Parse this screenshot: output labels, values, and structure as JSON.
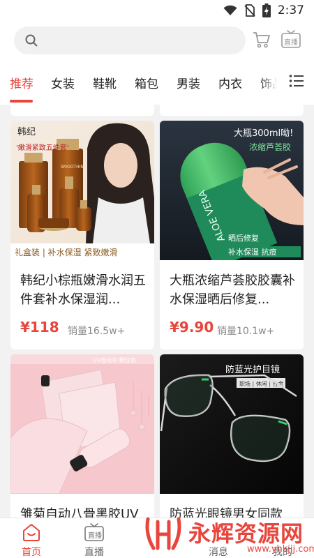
{
  "status_bar": {
    "time": "2:37",
    "icons": [
      "wifi-icon",
      "no-sim-icon",
      "battery-charging-icon"
    ]
  },
  "header": {
    "search": {
      "placeholder": "",
      "value": ""
    },
    "icons": [
      "cart-icon",
      "live-tv-icon"
    ],
    "live_badge": "直播"
  },
  "tabs": {
    "items": [
      "推荐",
      "女装",
      "鞋靴",
      "箱包",
      "男装",
      "内衣",
      "饰品"
    ],
    "active_index": 0,
    "menu_icon": "list-menu-icon"
  },
  "products": [
    {
      "title": "韩纪小棕瓶嫩滑水润五件套补水保湿润...",
      "price": "¥118",
      "sales": "销量16.5w+",
      "image": {
        "brand": "韩纪",
        "tag": "'嫩滑紧致五件套'",
        "bottle_label": "SMOOTHING",
        "bottom_text": "礼盒装 | 补水保湿 紧致嫩滑"
      }
    },
    {
      "title": "大瓶浓缩芦荟胶胶囊补水保湿晒后修复...",
      "price": "¥9.90",
      "sales": "销量10.1w+",
      "image": {
        "headline": "大瓶300ml呦!",
        "subline": "浓缩芦荟胶",
        "bottle_label": "ALOE VERA",
        "bottom_text_1": "晒后修复",
        "bottom_text_2": "补水保湿 抗痘"
      }
    },
    {
      "title": "雏菊自动八骨黑胶UV",
      "image": {
        "corner_text": "UV自动伞·粉红色"
      }
    },
    {
      "title": "防蓝光眼镜男女同款",
      "image": {
        "headline": "防蓝光护目镜",
        "subline": "职场 | 休闲 | 合金"
      }
    }
  ],
  "bottom_nav": {
    "items": [
      {
        "label": "首页",
        "icon": "home-icon"
      },
      {
        "label": "直播",
        "icon": "live-tv-icon"
      },
      {
        "label": "消息",
        "icon": "message-icon"
      },
      {
        "label": "我的",
        "icon": "profile-icon"
      }
    ],
    "active_index": 0,
    "live_badge": "直播"
  },
  "watermark": {
    "text": "永辉资源网",
    "url": "www.yhkjjj.com"
  },
  "colors": {
    "accent": "#e8453c",
    "background": "#f2f2f2",
    "aloe_green": "#4bc06a"
  }
}
